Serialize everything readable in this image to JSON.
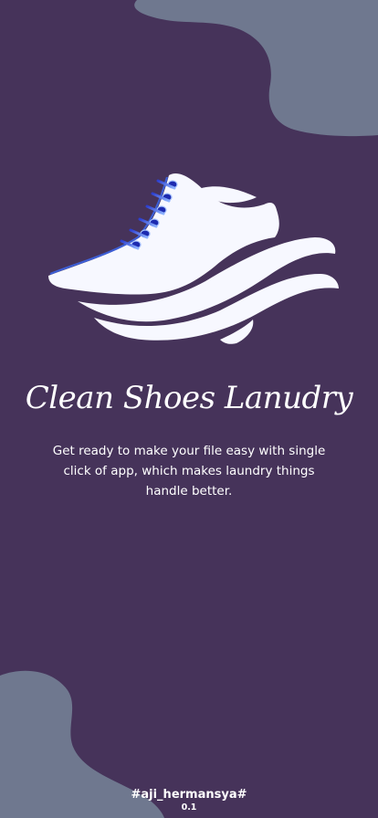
{
  "splash": {
    "logo_icon": "sneaker-icon",
    "title": "Clean Shoes Lanudry",
    "description": "Get ready to make your file easy with single click of app, which makes laundry things handle better.",
    "author_handle": "#aji_hermansya#",
    "version": "0.1"
  },
  "colors": {
    "background": "#46335a",
    "blob": "#6f788f",
    "text": "#ffffff",
    "shoe": "#f7f8ff",
    "lace_accent": "#3d5fd6"
  }
}
